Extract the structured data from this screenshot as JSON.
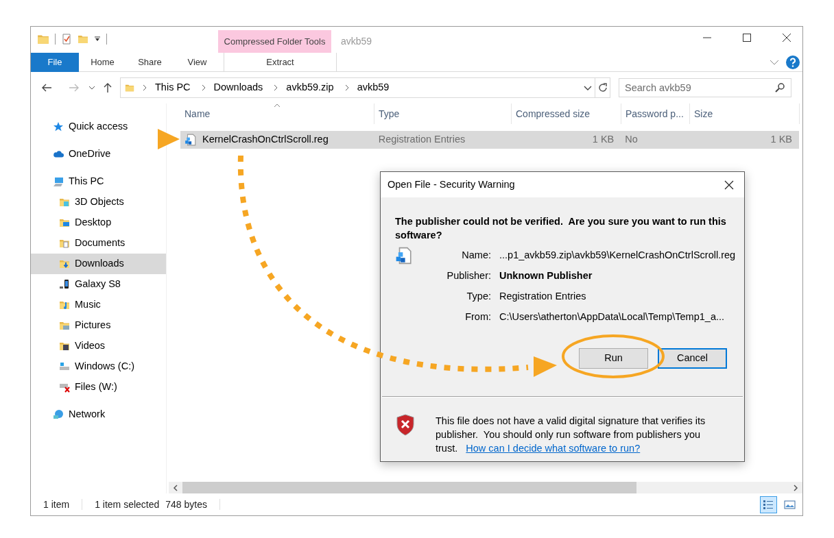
{
  "window": {
    "title": "avkb59",
    "context_tab": "Compressed Folder Tools"
  },
  "ribbon_tabs": [
    {
      "label": "File",
      "kind": "file"
    },
    {
      "label": "Home",
      "kind": "tab"
    },
    {
      "label": "Share",
      "kind": "tab"
    },
    {
      "label": "View",
      "kind": "tab"
    },
    {
      "label": "Extract",
      "kind": "context"
    }
  ],
  "address_bar": {
    "crumbs": [
      "This PC",
      "Downloads",
      "avkb59.zip",
      "avkb59"
    ]
  },
  "search": {
    "placeholder": "Search avkb59"
  },
  "sidebar": {
    "items": [
      {
        "label": "Quick access",
        "kind": "star",
        "selected": false
      },
      {
        "label": "OneDrive",
        "kind": "cloud",
        "selected": false
      },
      {
        "label": "This PC",
        "kind": "computer",
        "selected": false,
        "children": [
          {
            "label": "3D Objects",
            "kind": "objects",
            "selected": false
          },
          {
            "label": "Desktop",
            "kind": "desktop",
            "selected": false
          },
          {
            "label": "Documents",
            "kind": "documents",
            "selected": false
          },
          {
            "label": "Downloads",
            "kind": "downloads",
            "selected": true
          },
          {
            "label": "Galaxy S8",
            "kind": "phone",
            "selected": false
          },
          {
            "label": "Music",
            "kind": "music",
            "selected": false
          },
          {
            "label": "Pictures",
            "kind": "pictures",
            "selected": false
          },
          {
            "label": "Videos",
            "kind": "videos",
            "selected": false
          },
          {
            "label": "Windows (C:)",
            "kind": "drive",
            "selected": false
          },
          {
            "label": "Files (W:)",
            "kind": "netdrive",
            "selected": false
          }
        ]
      },
      {
        "label": "Network",
        "kind": "network",
        "selected": false
      }
    ]
  },
  "file_list": {
    "columns": [
      {
        "label": "Name",
        "kind": "name",
        "sorted": true
      },
      {
        "label": "Type",
        "kind": "text",
        "sorted": false
      },
      {
        "label": "Compressed size",
        "kind": "size",
        "sorted": false
      },
      {
        "label": "Password p...",
        "kind": "text",
        "sorted": false
      },
      {
        "label": "Size",
        "kind": "size",
        "sorted": false
      }
    ],
    "rows": [
      {
        "cells": [
          "KernelCrashOnCtrlScroll.reg",
          "Registration Entries",
          "1 KB",
          "No",
          "1 KB"
        ],
        "selected": true
      }
    ]
  },
  "status_bar": {
    "item_count": "1 item",
    "selection": "1 item selected",
    "selection_size": "748 bytes",
    "views": [
      {
        "kind": "details",
        "selected": true
      },
      {
        "kind": "preview",
        "selected": false
      }
    ]
  },
  "dialog": {
    "title": "Open File - Security Warning",
    "question": "The publisher could not be verified.  Are you sure you want to run this software?",
    "fields": [
      {
        "label": "Name:",
        "value": "...p1_avkb59.zip\\avkb59\\KernelCrashOnCtrlScroll.reg",
        "bold": false
      },
      {
        "label": "Publisher:",
        "value": "Unknown Publisher",
        "bold": true
      },
      {
        "label": "Type:",
        "value": "Registration Entries",
        "bold": false
      },
      {
        "label": "From:",
        "value": "C:\\Users\\atherton\\AppData\\Local\\Temp\\Temp1_a...",
        "bold": false
      }
    ],
    "buttons": [
      {
        "label": "Run",
        "default": false
      },
      {
        "label": "Cancel",
        "default": true
      }
    ],
    "warning": "This file does not have a valid digital signature that verifies its publisher.  You should only run software from publishers you trust.",
    "link": "How can I decide what software to run?"
  }
}
